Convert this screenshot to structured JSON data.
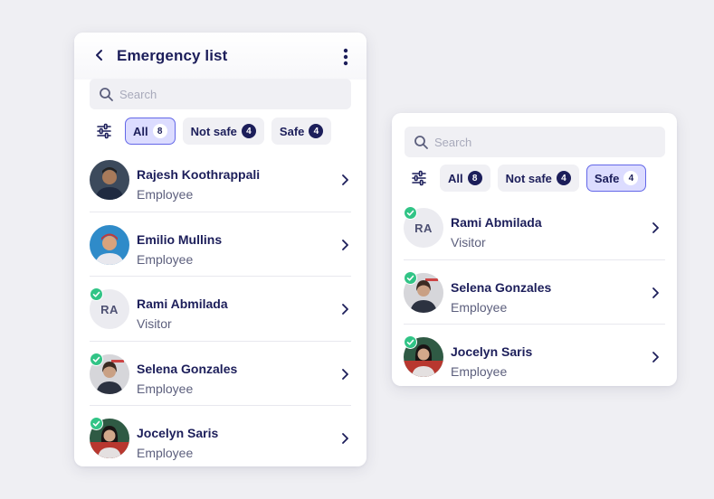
{
  "left": {
    "title": "Emergency list",
    "search_placeholder": "Search",
    "filters": [
      {
        "label": "All",
        "count": "8",
        "active": true
      },
      {
        "label": "Not safe",
        "count": "4",
        "active": false
      },
      {
        "label": "Safe",
        "count": "4",
        "active": false
      }
    ],
    "rows": [
      {
        "name": "Rajesh Koothrappali",
        "role": "Employee",
        "safe": false,
        "initials": ""
      },
      {
        "name": "Emilio Mullins",
        "role": "Employee",
        "safe": false,
        "initials": ""
      },
      {
        "name": "Rami Abmilada",
        "role": "Visitor",
        "safe": true,
        "initials": "RA"
      },
      {
        "name": "Selena Gonzales",
        "role": "Employee",
        "safe": true,
        "initials": ""
      },
      {
        "name": "Jocelyn Saris",
        "role": "Employee",
        "safe": true,
        "initials": ""
      }
    ]
  },
  "right": {
    "search_placeholder": "Search",
    "filters": [
      {
        "label": "All",
        "count": "8",
        "active": false
      },
      {
        "label": "Not safe",
        "count": "4",
        "active": false
      },
      {
        "label": "Safe",
        "count": "4",
        "active": true
      }
    ],
    "rows": [
      {
        "name": "Rami Abmilada",
        "role": "Visitor",
        "safe": true,
        "initials": "RA"
      },
      {
        "name": "Selena Gonzales",
        "role": "Employee",
        "safe": true,
        "initials": ""
      },
      {
        "name": "Jocelyn Saris",
        "role": "Employee",
        "safe": true,
        "initials": ""
      }
    ]
  },
  "colors": {
    "primary": "#1c1e5a",
    "active_chip": "#dcdcff",
    "active_border": "#6367e8",
    "safe_check": "#31c486"
  }
}
